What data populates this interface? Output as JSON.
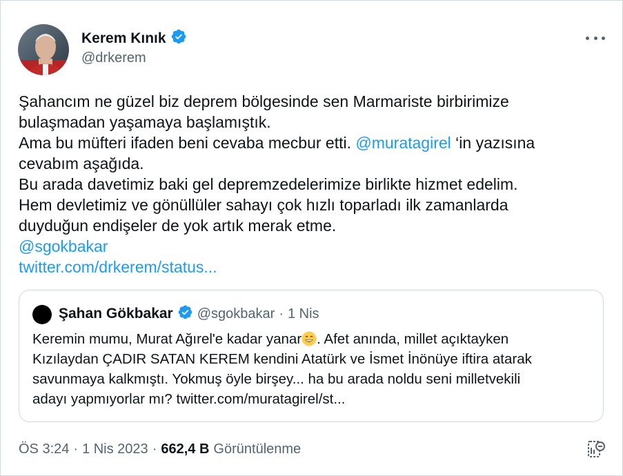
{
  "author": {
    "name": "Kerem Kınık",
    "handle": "@drkerem",
    "verified": true
  },
  "tweet": {
    "lines": [
      "Şahancım ne güzel biz deprem bölgesinde sen Marmariste birbirimize",
      "bulaşmadan yaşamaya başlamıştık.",
      "Ama bu müfteri ifaden beni cevaba mecbur etti. ",
      "cevabım aşağıda.",
      "Bu arada davetimiz baki gel depremzedelerimize birlikte hizmet edelim.",
      "Hem devletimiz ve gönüllüler sahayı çok hızlı toparladı ilk zamanlarda",
      "duyduğun endişeler de yok artık merak etme."
    ],
    "mention_inline": "@muratagirel",
    "after_mention": " ‘in yazısına",
    "mention_link": "@sgokbakar",
    "url_link": "twitter.com/drkerem/status..."
  },
  "quote": {
    "name": "Şahan Gökbakar",
    "handle": "@sgokbakar",
    "separator": "·",
    "date": "1 Nis",
    "text_before_emoji": "Keremin mumu, Murat Ağırel'e kadar yanar",
    "text_after_emoji": ". Afet anında, millet açıktayken",
    "lines": [
      "Kızılaydan ÇADIR SATAN KEREM kendini Atatürk ve İsmet İnönüye iftira atarak",
      "savunmaya kalkmıştı. Yokmuş öyle birşey... ha bu arada noldu seni milletvekili",
      "adayı yapmıyorlar mı? twitter.com/muratagirel/st..."
    ]
  },
  "footer": {
    "time": "ÖS 3:24",
    "separator": "·",
    "date": "1 Nis 2023",
    "views_count": "662,4 B",
    "views_label": "Görüntülenme"
  },
  "colors": {
    "link": "#1d9bf0",
    "secondary_text": "#536471",
    "border": "#cfd9de",
    "verified": "#1d9bf0"
  },
  "icons": [
    "verified-badge-icon",
    "more-options-icon",
    "emoji-grin-icon",
    "view-analytics-icon"
  ]
}
